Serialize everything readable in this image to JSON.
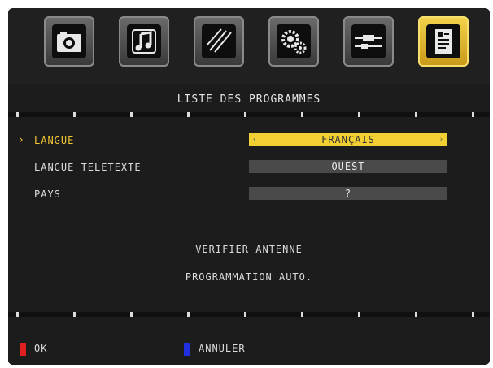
{
  "tabs": [
    {
      "icon": "photo-camera-icon"
    },
    {
      "icon": "music-note-icon"
    },
    {
      "icon": "picture-diagonal-lines-icon"
    },
    {
      "icon": "gears-icon"
    },
    {
      "icon": "connector-cable-icon"
    },
    {
      "icon": "document-list-icon",
      "active": true
    }
  ],
  "title": "LISTE DES PROGRAMMES",
  "settings": [
    {
      "label": "LANGUE",
      "value": "FRANÇAIS",
      "selected": true
    },
    {
      "label": "LANGUE TELETEXTE",
      "value": "OUEST"
    },
    {
      "label": "PAYS",
      "value": "?"
    }
  ],
  "cursor": "›",
  "value_arrows": {
    "left": "‹",
    "right": "›"
  },
  "actions": {
    "check_antenna": "VERIFIER ANTENNE",
    "auto_program": "PROGRAMMATION AUTO."
  },
  "footer": {
    "ok_label": "OK",
    "cancel_label": "ANNULER"
  },
  "colors": {
    "accent": "#f2c733",
    "ok_key": "#e02020",
    "cancel_key": "#2030e0"
  }
}
